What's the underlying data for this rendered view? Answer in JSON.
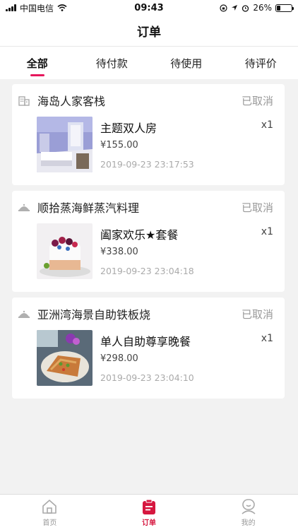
{
  "status_bar": {
    "carrier": "中国电信",
    "time": "09:43",
    "battery": "26%",
    "battery_level": 0.26
  },
  "header": {
    "title": "订单"
  },
  "tabs": [
    {
      "label": "全部"
    },
    {
      "label": "待付款"
    },
    {
      "label": "待使用"
    },
    {
      "label": "待评价"
    }
  ],
  "orders": [
    {
      "store": "海岛人家客栈",
      "status": "已取消",
      "product": "主题双人房",
      "price": "¥155.00",
      "time": "2019-09-23 23:17:53",
      "qty": "x1"
    },
    {
      "store": "顺拾蒸海鲜蒸汽料理",
      "status": "已取消",
      "product": "阖家欢乐★套餐",
      "price": "¥338.00",
      "time": "2019-09-23 23:04:18",
      "qty": "x1"
    },
    {
      "store": "亚洲湾海景自助铁板烧",
      "status": "已取消",
      "product": "单人自助尊享晚餐",
      "price": "¥298.00",
      "time": "2019-09-23 23:04:10",
      "qty": "x1"
    }
  ],
  "tab_bar": [
    {
      "label": "首页",
      "icon": "home-icon"
    },
    {
      "label": "订单",
      "icon": "order-icon"
    },
    {
      "label": "我的",
      "icon": "profile-icon"
    }
  ],
  "colors": {
    "accent": "#e6175c",
    "tab_active": "#d6173f",
    "muted": "#999999"
  }
}
